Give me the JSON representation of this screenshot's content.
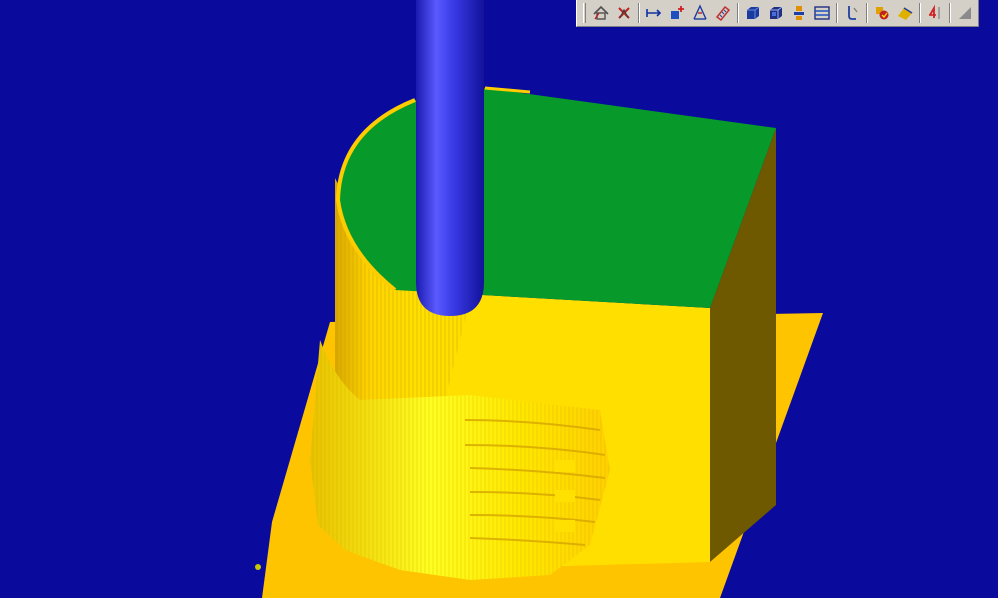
{
  "viewport": {
    "background_color": "#0a0a9c",
    "colors": {
      "tool": "#3a3ae6",
      "stock_top": "#079a2a",
      "stock_front": "#ffdf00",
      "stock_side": "#6e5800",
      "base_plate": "#ffc400",
      "machined_surface": "#ffff10"
    }
  },
  "toolbar": {
    "buttons": [
      {
        "name": "home-view-icon"
      },
      {
        "name": "reset-icon"
      },
      {
        "name": "measure-distance-icon"
      },
      {
        "name": "add-point-icon"
      },
      {
        "name": "angle-measure-icon"
      },
      {
        "name": "ruler-icon"
      },
      {
        "name": "solid-view-icon"
      },
      {
        "name": "shaded-view-icon"
      },
      {
        "name": "stock-icon"
      },
      {
        "name": "section-icon"
      },
      {
        "name": "tool-path-icon"
      },
      {
        "name": "compare-icon"
      },
      {
        "name": "simulate-icon"
      },
      {
        "name": "step-icon"
      },
      {
        "name": "resize-grip-icon"
      }
    ]
  }
}
